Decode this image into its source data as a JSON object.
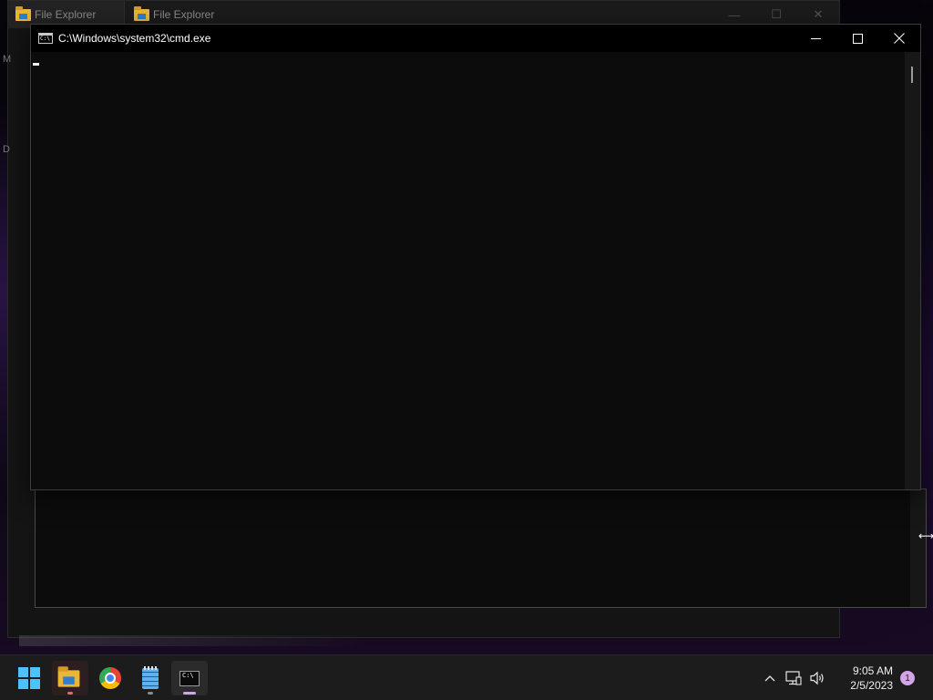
{
  "background_windows": {
    "tabs": [
      {
        "label": "File Explorer"
      },
      {
        "label": "File Explorer"
      }
    ],
    "edge_fragments": [
      "M",
      "D"
    ]
  },
  "cmd_window": {
    "title": "C:\\Windows\\system32\\cmd.exe",
    "icon": "console-icon",
    "caption": {
      "minimize": "—",
      "maximize": "☐",
      "close": "✕"
    }
  },
  "taskbar": {
    "apps": [
      {
        "name": "Start",
        "icon": "windows-icon"
      },
      {
        "name": "File Explorer",
        "icon": "folder-icon"
      },
      {
        "name": "Google Chrome",
        "icon": "chrome-icon"
      },
      {
        "name": "Notepad",
        "icon": "notepad-icon"
      },
      {
        "name": "Command Prompt",
        "icon": "terminal-icon"
      }
    ],
    "tray": {
      "chevron": "^",
      "clock_time": "9:05 AM",
      "clock_date": "2/5/2023",
      "notification_count": "1"
    }
  },
  "colors": {
    "accent": "#4cc2ff",
    "fe_indicator": "#e26a6a",
    "cmd_indicator": "#d3a5e6",
    "console_bg": "#0c0c0c"
  }
}
